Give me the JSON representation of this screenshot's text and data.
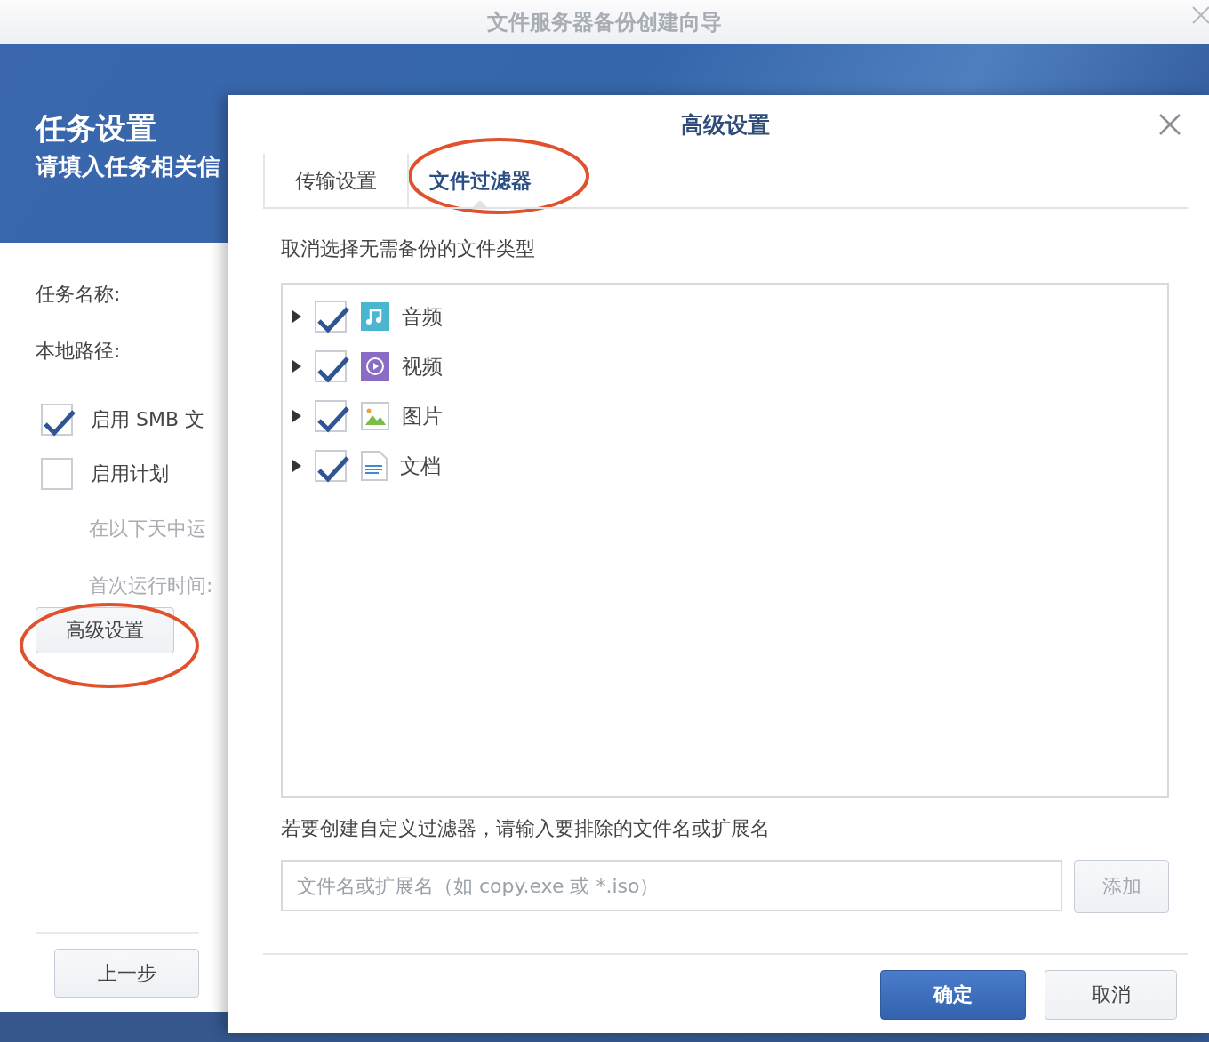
{
  "wizard": {
    "title": "文件服务器备份创建向导",
    "header": {
      "title": "任务设置",
      "subtitle": "请填入任务相关信"
    },
    "fields": [
      {
        "label": "任务名称:"
      },
      {
        "label": "本地路径:"
      }
    ],
    "options": [
      {
        "label": "启用 SMB 文",
        "checked": true
      },
      {
        "label": "启用计划",
        "checked": false
      }
    ],
    "schedule_fields": [
      {
        "label": "在以下天中运",
        "disabled": true
      },
      {
        "label": "首次运行时间:",
        "disabled": true
      }
    ],
    "advanced_button": "高级设置",
    "back_button": "上一步"
  },
  "dialog": {
    "title": "高级设置",
    "tabs": [
      {
        "label": "传输设置",
        "selected": false
      },
      {
        "label": "文件过滤器",
        "selected": true
      }
    ],
    "filter_hint": "取消选择无需备份的文件类型",
    "file_types": [
      {
        "label": "音频",
        "kind": "audio",
        "checked": true,
        "expanded": false
      },
      {
        "label": "视频",
        "kind": "video",
        "checked": true,
        "expanded": false
      },
      {
        "label": "图片",
        "kind": "image",
        "checked": true,
        "expanded": false
      },
      {
        "label": "文档",
        "kind": "document",
        "checked": true,
        "expanded": false
      }
    ],
    "custom_hint": "若要创建自定义过滤器，请输入要排除的文件名或扩展名",
    "input": {
      "placeholder": "文件名或扩展名（如 copy.exe 或 *.iso）"
    },
    "add_button": {
      "label": "添加",
      "disabled": true
    },
    "buttons": [
      {
        "label": "确定",
        "primary": true
      },
      {
        "label": "取消",
        "primary": false
      }
    ]
  }
}
